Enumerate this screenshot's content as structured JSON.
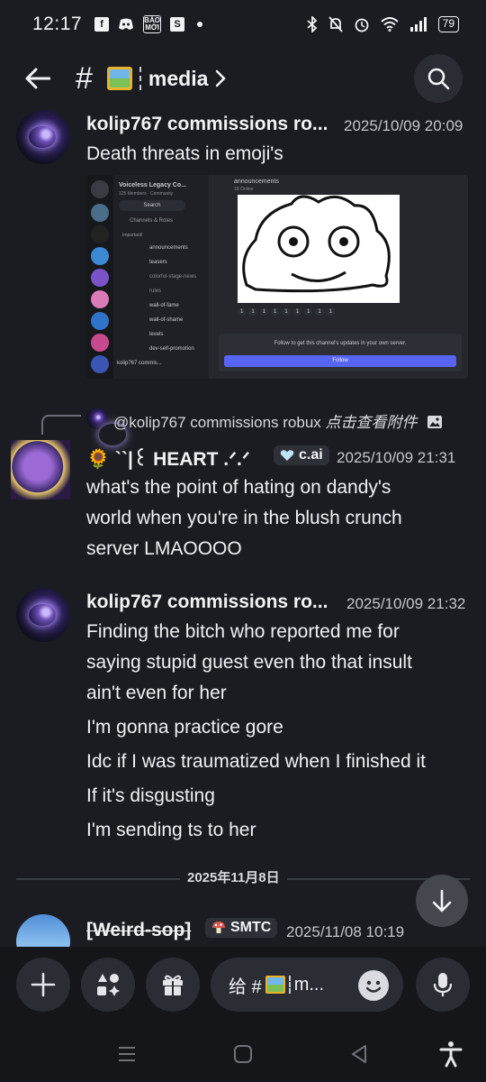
{
  "status_bar": {
    "time": "12:17",
    "left_badges": [
      "f",
      "discord",
      "BÁO MỚI",
      "S"
    ],
    "battery": "79"
  },
  "header": {
    "channel_name": "media",
    "channel_emoji": "framed-picture-icon"
  },
  "messages": [
    {
      "author": "kolip767 commissions ro...",
      "timestamp": "2025/10/09 20:09",
      "lines": [
        "Death threats in emoji's"
      ],
      "attachment": {
        "server": "Voiceless Legacy Co...",
        "server_sub": "125 Members · Community",
        "search": "Search",
        "channels_roles": "Channels & Roles",
        "important": "Important!",
        "channels": [
          "announcements",
          "teasers",
          "colorful-stage-news",
          "rules",
          "wall-of-fame",
          "wall-of-shame",
          "levels",
          "dev-self-promotion"
        ],
        "user": "kolip767 commis...",
        "top_channel": "announcements",
        "top_sub": "19 Online",
        "follow_text": "Follow to get this channel's updates in your own server.",
        "follow_button": "Follow",
        "reactions": [
          "1",
          "1",
          "1",
          "1",
          "1",
          "1",
          "1",
          "1",
          "1"
        ]
      }
    },
    {
      "reply_to": "@kolip767 commissions robux",
      "reply_hint": "点击查看附件",
      "author": "🌻 ``|꒰ HEART .ᐟ.ᐟ",
      "tag": "c.ai",
      "timestamp": "2025/10/09 21:31",
      "lines": [
        "what's the point of hating on dandy's",
        "world when you're in the blush crunch",
        "server LMAOOOO"
      ]
    },
    {
      "author": "kolip767 commissions ro...",
      "timestamp": "2025/10/09 21:32",
      "lines": [
        "Finding the bitch who reported me for",
        "saying stupid guest even tho that insult",
        "ain't even for her",
        "I'm gonna practice gore",
        "Idc if I was traumatized when I finished it",
        "If it's disgusting",
        "I'm sending ts to her"
      ]
    },
    {
      "author": "[Weird-sop]",
      "tag": "SMTC",
      "timestamp": "2025/11/08 10:19",
      "lines": []
    }
  ],
  "date_divider": "2025年11月8日",
  "composer": {
    "placeholder_prefix": "给 #",
    "placeholder_suffix": "m..."
  },
  "colors": {
    "background": "#1b1c22",
    "accent": "#5865f2",
    "surface": "#2b2d35"
  }
}
